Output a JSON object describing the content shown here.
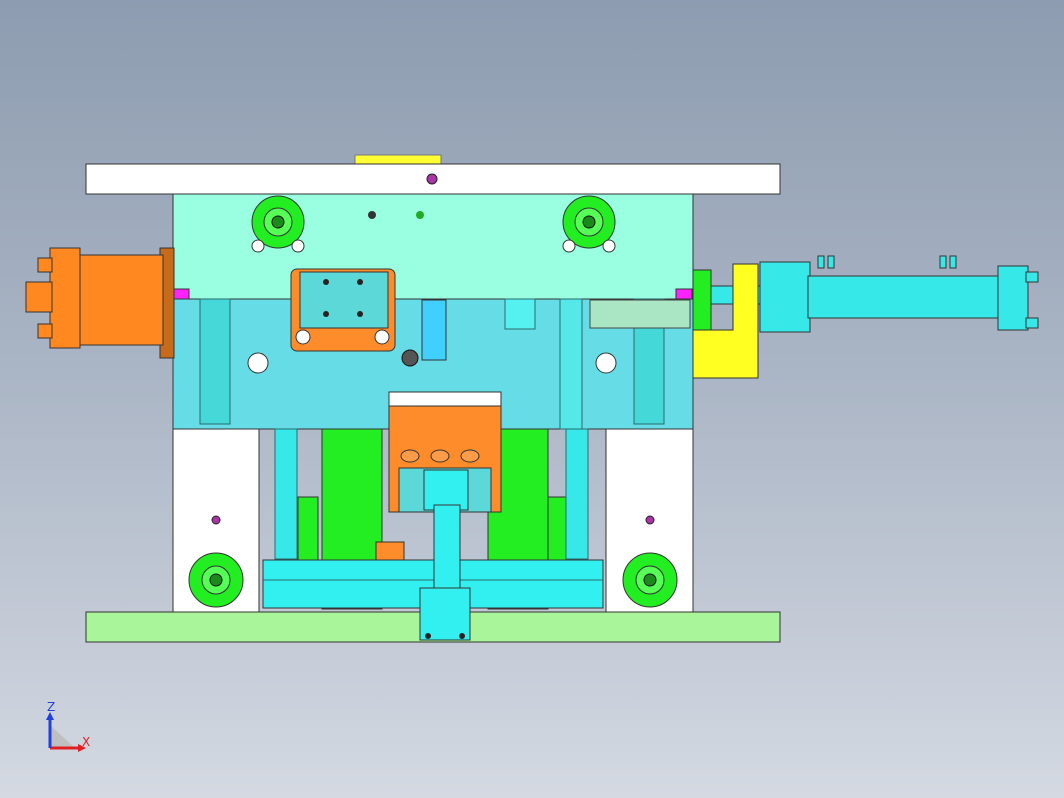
{
  "viewport": {
    "background_top": "#8d9cb0",
    "background_bottom": "#d4d9e2"
  },
  "axis_triad": {
    "x_label": "X",
    "z_label": "Z",
    "x_color": "#e02020",
    "z_color": "#2040e0"
  },
  "model": {
    "colors": {
      "top_clamp_plate": "#ffffff",
      "a_plate": "#99ffe0",
      "b_plate": "#66dce6",
      "support_block": "#ffffff",
      "bottom_clamp_plate": "#a8f59a",
      "ejector_plate": "#33f0f0",
      "cylinder": "#36e8e8",
      "hydraulic_motor": "#ff8820",
      "bracket": "#ffff22",
      "guide_pillar": "#22ee22",
      "orange_block": "#ff8c2a",
      "sprue_ring": "#ffff33",
      "magenta_pad": "#ff22ff",
      "green_pad": "#22ee22"
    }
  }
}
